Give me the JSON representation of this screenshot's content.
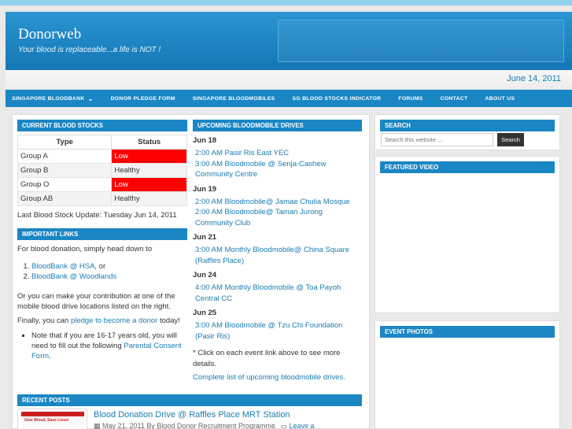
{
  "site": {
    "title": "Donorweb",
    "tagline": "Your blood is replaceable...a life is NOT !",
    "date": "June 14, 2011"
  },
  "nav": {
    "items": [
      "SINGAPORE BLOODBANK",
      "DONOR PLEDGE FORM",
      "SINGAPORE BLOODMOBILES",
      "SG BLOOD STOCKS INDICATOR",
      "FORUMS",
      "CONTACT",
      "ABOUT US"
    ]
  },
  "blood_stocks": {
    "title": "CURRENT BLOOD STOCKS",
    "headers": [
      "Type",
      "Status"
    ],
    "rows": [
      {
        "type": "Group A",
        "status": "Low"
      },
      {
        "type": "Group B",
        "status": "Healthy"
      },
      {
        "type": "Group O",
        "status": "Low"
      },
      {
        "type": "Group AB",
        "status": "Healthy"
      }
    ],
    "status_color_low": "#ff0000",
    "update": "Last Blood Stock Update: Tuesday Jun 14, 2011"
  },
  "important_links": {
    "title": "IMPORTANT LINKS",
    "intro": "For blood donation, simply head down to",
    "link1": "BloodBank @ HSA",
    "link1_suffix": ", or",
    "link2": "BloodBank @ Woodlands",
    "para2": "Or you can make your contribution at one of the mobile blood drive locations listed on the right.",
    "para3_prefix": "Finally, you can ",
    "para3_link": "pledge to become a donor",
    "para3_suffix": " today!",
    "note_prefix": "Note that if you are 16-17 years old, you will need to fill out the following ",
    "note_link": "Parental Consent Form",
    "note_suffix": "."
  },
  "bloodmobile": {
    "title": "UPCOMING BLOODMOBILE DRIVES",
    "d1": "Jun 18",
    "d1_e1": "2:00 AM Pasir Ris East YEC",
    "d1_e2": "3:00 AM Bloodmobile @ Senja-Cashew Community Centre",
    "d2": "Jun 19",
    "d2_e1": "2:00 AM Bloodmobile@ Jamae Chulia Mosque",
    "d2_e2": "2:00 AM Bloodmobile@ Taman Jurong Community Club",
    "d3": "Jun 21",
    "d3_e1": "3:00 AM Monthly Bloodmobile@ China Square (Raffles Place)",
    "d4": "Jun 24",
    "d4_e1": "4:00 AM Monthly Bloodmobile @ Toa Payoh Central CC",
    "d5": "Jun 25",
    "d5_e1": "3:00 AM Bloodmobile @ Tzu Chi Foundation (Pasir Ris)",
    "footnote": "* Click on each event link above to see more details.",
    "complete_link": "Complete list of upcoming bloodmobile drives."
  },
  "recent_posts": {
    "title": "RECENT POSTS",
    "post_title": "Blood Donation Drive @ Raffles Place MRT Station",
    "post_meta": "May 21, 2011 By Blood Donor Recruitment Programme",
    "leave_comment": "Leave a",
    "thumb_text": "Give Blood, Save Lives!"
  },
  "sidebar": {
    "search_title": "SEARCH",
    "search_placeholder": "Search this website ...",
    "search_button": "Search",
    "featured_title": "FEATURED VIDEO",
    "photos_title": "EVENT PHOTOS"
  }
}
